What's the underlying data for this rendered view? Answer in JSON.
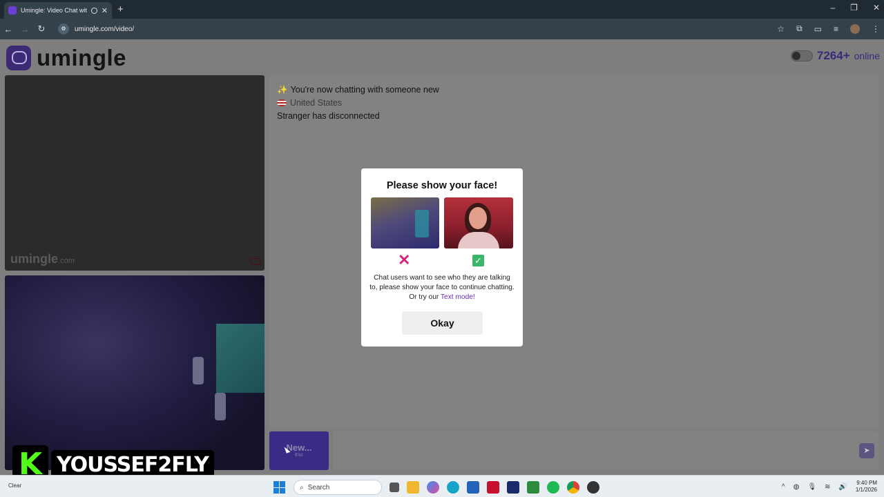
{
  "browser": {
    "tab_title": "Umingle: Video Chat with S",
    "new_tab": "+",
    "url": "umingle.com/video/",
    "window_controls": [
      "–",
      "❐",
      "✕"
    ]
  },
  "site": {
    "logo_text": "umingle",
    "online_count": "7264+",
    "online_label": "online"
  },
  "remote_video": {
    "watermark": "umingle",
    "watermark_suffix": ".com"
  },
  "chat": {
    "message_1": "You're now chatting with someone new",
    "message_2": "United States",
    "message_3": "Stranger has disconnected"
  },
  "controls": {
    "new_label": "New...",
    "new_hint": "Esc",
    "send_icon": "send-icon"
  },
  "modal": {
    "title": "Please show your face!",
    "desc_text": "Chat users want to see who they are talking to, please show your face to continue chatting. Or try our ",
    "desc_link": "Text mode!",
    "okay_label": "Okay"
  },
  "overlay": {
    "badge": "K",
    "streamer": "YOUSSEF2FLY"
  },
  "taskbar": {
    "weather": "Clear",
    "search_placeholder": "Search",
    "time": "9:40 PM",
    "date": "1/1/2026"
  },
  "colors": {
    "brand": "#3b2b86",
    "link": "#6b2bb0",
    "reject": "#d4267a",
    "accept": "#3bb56a"
  }
}
